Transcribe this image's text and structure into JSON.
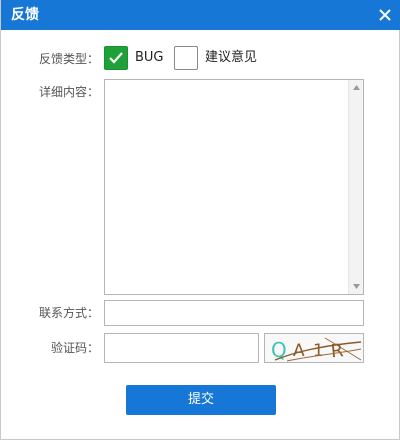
{
  "window": {
    "title": "反馈",
    "close_icon": "close-icon",
    "accent_color": "#1677d6"
  },
  "feedback_type": {
    "label": "反馈类型：",
    "options": [
      {
        "label": "BUG",
        "checked": true,
        "check_color": "#1fa13a"
      },
      {
        "label": "建议意见",
        "checked": false
      }
    ]
  },
  "details": {
    "label": "详细内容：",
    "value": ""
  },
  "contact": {
    "label": "联系方式：",
    "value": ""
  },
  "captcha": {
    "label": "验证码：",
    "value": "",
    "image_text": "QA1R"
  },
  "actions": {
    "submit_label": "提交"
  }
}
